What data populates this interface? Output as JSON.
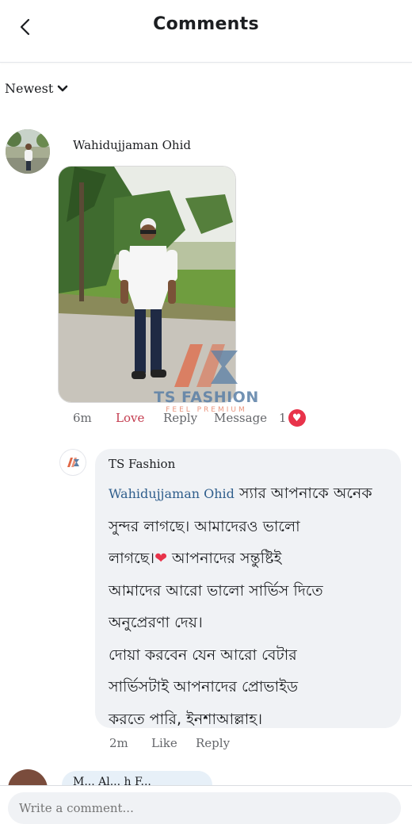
{
  "header": {
    "title": "Comments"
  },
  "sort": {
    "label": "Newest"
  },
  "comment": {
    "author": "Wahidujjaman Ohid",
    "time": "6m",
    "love": "Love",
    "reply": "Reply",
    "message": "Message",
    "reaction_count": "1"
  },
  "watermark": {
    "brand": "TS FASHION",
    "tagline": "FEEL PREMIUM"
  },
  "reply_comment": {
    "author": "TS Fashion",
    "mention": "Wahidujjaman Ohid",
    "line1": " স্যার আপনাকে  অনেক",
    "line2": "সুন্দর লাগছে। আমাদেরও ভালো",
    "line3a": "লাগছে।",
    "line3b": " আপনাদের সন্তুষ্টিই",
    "line4": "আমাদের আরো ভালো সার্ভিস দিতে",
    "line5": "অনুপ্রেরণা দেয়।",
    "line6": "দোয়া করবেন যেন আরো বেটার",
    "line7": "সার্ভিসটাই আপনাদের প্রোভাইড",
    "line8": "করতে পারি, ইনশাআল্লাহ।",
    "time": "2m",
    "like": "Like",
    "reply": "Reply"
  },
  "next_comment": {
    "author_partial": "M... Al... h F..."
  },
  "composer": {
    "placeholder": "Write a comment..."
  },
  "colors": {
    "love": "#c33b4e",
    "mention": "#2f5e8c",
    "bubble": "#f0f2f5",
    "heart": "#e8334a"
  }
}
